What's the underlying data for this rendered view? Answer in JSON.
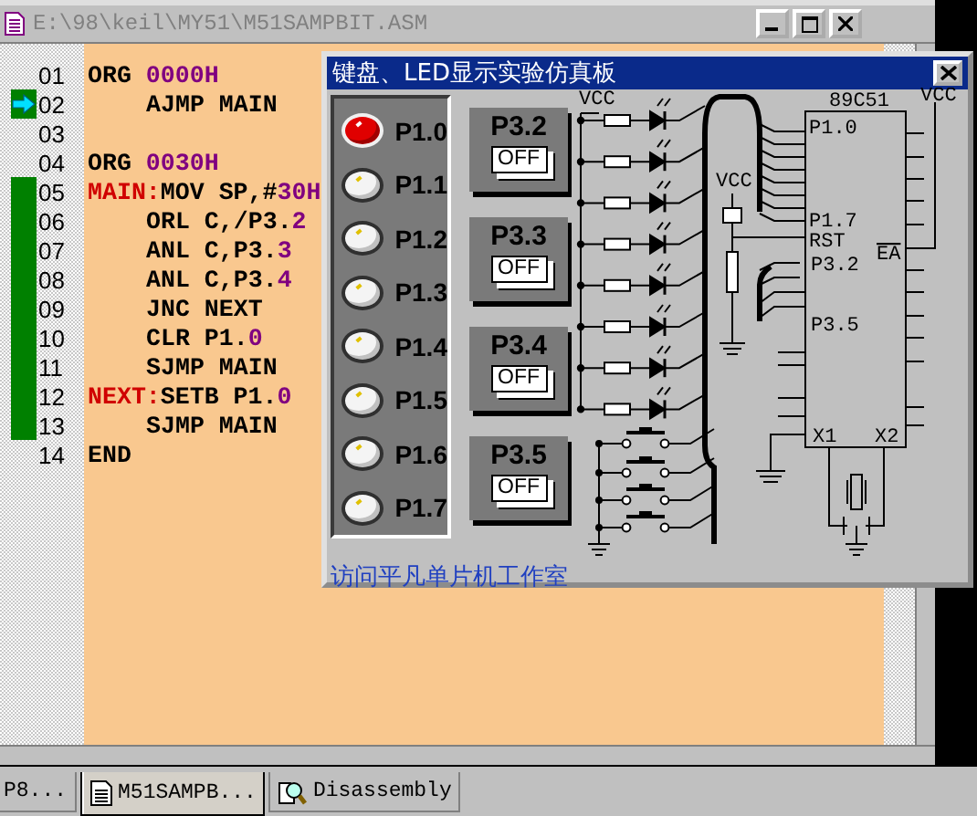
{
  "editor": {
    "title": "E:\\98\\keil\\MY51\\M51SAMPBIT.ASM",
    "lines": [
      {
        "number": "01",
        "executed": false,
        "current": false,
        "indent": false,
        "tokens": [
          {
            "t": "ORG ",
            "kind": "kw"
          },
          {
            "t": "0000H",
            "kind": "num"
          }
        ]
      },
      {
        "number": "02",
        "executed": true,
        "current": true,
        "indent": true,
        "tokens": [
          {
            "t": "AJMP MAIN",
            "kind": "kw"
          }
        ]
      },
      {
        "number": "03",
        "executed": false,
        "current": false
      },
      {
        "number": "04",
        "executed": false,
        "current": false,
        "indent": false,
        "tokens": [
          {
            "t": "ORG ",
            "kind": "kw"
          },
          {
            "t": "0030H",
            "kind": "num"
          }
        ]
      },
      {
        "number": "05",
        "executed": true,
        "current": false,
        "indent": false,
        "tokens": [
          {
            "t": "MAIN:",
            "kind": "label"
          },
          {
            "t": "MOV SP,#",
            "kind": "kw"
          },
          {
            "t": "30H",
            "kind": "num"
          }
        ]
      },
      {
        "number": "06",
        "executed": true,
        "current": false,
        "indent": true,
        "tokens": [
          {
            "t": "ORL C,/P3.",
            "kind": "kw"
          },
          {
            "t": "2",
            "kind": "num"
          }
        ]
      },
      {
        "number": "07",
        "executed": true,
        "current": false,
        "indent": true,
        "tokens": [
          {
            "t": "ANL C,P3.",
            "kind": "kw"
          },
          {
            "t": "3",
            "kind": "num"
          }
        ]
      },
      {
        "number": "08",
        "executed": true,
        "current": false,
        "indent": true,
        "tokens": [
          {
            "t": "ANL C,P3.",
            "kind": "kw"
          },
          {
            "t": "4",
            "kind": "num"
          }
        ]
      },
      {
        "number": "09",
        "executed": true,
        "current": false,
        "indent": true,
        "tokens": [
          {
            "t": "JNC NEXT",
            "kind": "kw"
          }
        ]
      },
      {
        "number": "10",
        "executed": true,
        "current": false,
        "indent": true,
        "tokens": [
          {
            "t": "CLR P1.",
            "kind": "kw"
          },
          {
            "t": "0",
            "kind": "num"
          }
        ]
      },
      {
        "number": "11",
        "executed": true,
        "current": false,
        "indent": true,
        "tokens": [
          {
            "t": "SJMP MAIN",
            "kind": "kw"
          }
        ]
      },
      {
        "number": "12",
        "executed": true,
        "current": false,
        "indent": false,
        "tokens": [
          {
            "t": "NEXT:",
            "kind": "label"
          },
          {
            "t": "SETB P1.",
            "kind": "kw"
          },
          {
            "t": "0",
            "kind": "num"
          }
        ]
      },
      {
        "number": "13",
        "executed": true,
        "current": false,
        "indent": true,
        "tokens": [
          {
            "t": "SJMP MAIN",
            "kind": "kw"
          }
        ]
      },
      {
        "number": "14",
        "executed": false,
        "current": false,
        "indent": false,
        "tokens": [
          {
            "t": "END",
            "kind": "kw"
          }
        ]
      }
    ]
  },
  "dialog": {
    "title": "键盘、LED显示实验仿真板",
    "leds": [
      {
        "label": "P1.0",
        "on": true
      },
      {
        "label": "P1.1",
        "on": false
      },
      {
        "label": "P1.2",
        "on": false
      },
      {
        "label": "P1.3",
        "on": false
      },
      {
        "label": "P1.4",
        "on": false
      },
      {
        "label": "P1.5",
        "on": false
      },
      {
        "label": "P1.6",
        "on": false
      },
      {
        "label": "P1.7",
        "on": false
      }
    ],
    "switches": [
      {
        "label": "P3.2",
        "state": "OFF",
        "on": false
      },
      {
        "label": "P3.3",
        "state": "OFF",
        "on": false
      },
      {
        "label": "P3.4",
        "state": "OFF",
        "on": false
      },
      {
        "label": "P3.5",
        "state": "OFF",
        "on": false
      }
    ],
    "circuit": {
      "vcc_left": "VCC",
      "vcc_middle": "VCC",
      "vcc_right": "VCC",
      "chip": "89C51",
      "pin_p10": "P1.0",
      "pin_p17": "P1.7",
      "pin_rst": "RST",
      "pin_p32": "P3.2",
      "pin_p35": "P3.5",
      "pin_ea": "EA",
      "pin_x1": "X1",
      "pin_x2": "X2"
    },
    "link": "访问平凡单片机工作室"
  },
  "tabs": [
    {
      "label": "P8...",
      "selected": false,
      "kind": "plain"
    },
    {
      "label": "M51SAMPB...",
      "selected": true,
      "kind": "file"
    },
    {
      "label": "Disassembly",
      "selected": false,
      "kind": "disassembly"
    }
  ]
}
